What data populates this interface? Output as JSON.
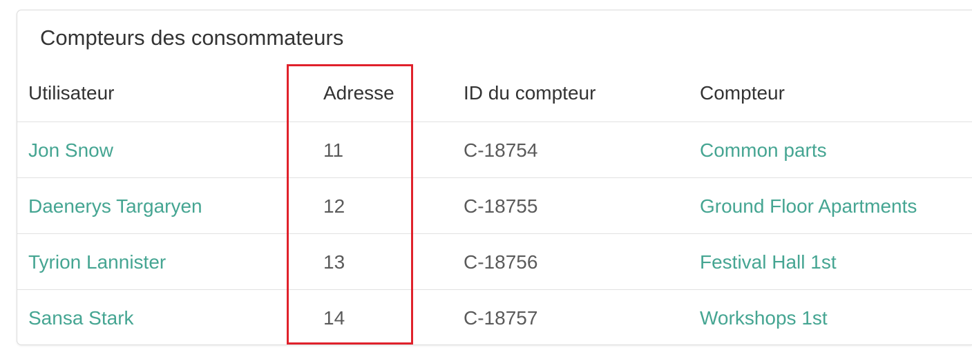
{
  "card": {
    "title": "Compteurs des consommateurs"
  },
  "table": {
    "headers": {
      "user": "Utilisateur",
      "address": "Adresse",
      "meter_id": "ID du compteur",
      "meter": "Compteur"
    },
    "rows": [
      {
        "user": "Jon Snow",
        "address": "11",
        "meter_id": "C-18754",
        "meter": "Common parts"
      },
      {
        "user": "Daenerys Targaryen",
        "address": "12",
        "meter_id": "C-18755",
        "meter": "Ground Floor Apartments"
      },
      {
        "user": "Tyrion Lannister",
        "address": "13",
        "meter_id": "C-18756",
        "meter": "Festival Hall 1st"
      },
      {
        "user": "Sansa Stark",
        "address": "14",
        "meter_id": "C-18757",
        "meter": "Workshops 1st"
      }
    ]
  },
  "colors": {
    "link": "#45a592",
    "highlight_border": "#e0212b",
    "text": "#333333"
  }
}
